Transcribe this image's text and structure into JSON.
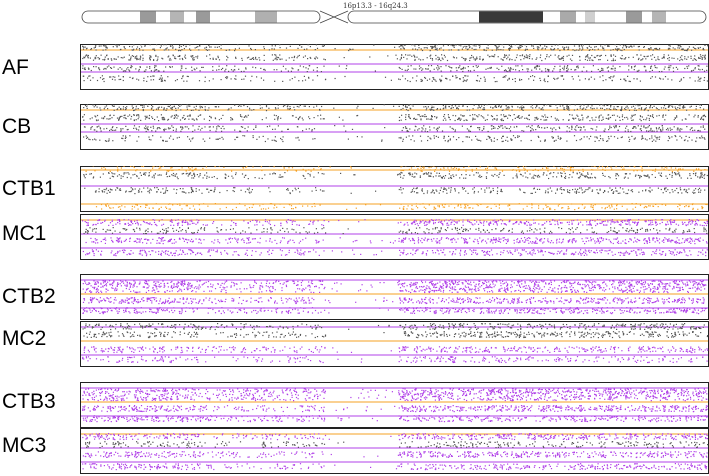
{
  "chromosome": {
    "region_label": "16p13.3 - 16q24.3"
  },
  "colors": {
    "purple": "#b040e8",
    "orange": "#f5a023",
    "gray": "#555555",
    "frame": "#222222"
  },
  "tracks": [
    {
      "id": "AF",
      "label": "AF",
      "style": "parent"
    },
    {
      "id": "CB",
      "label": "CB",
      "style": "parent"
    },
    {
      "id": "CTB1",
      "label": "CTB1",
      "style": "ctb1"
    },
    {
      "id": "MC1",
      "label": "MC1",
      "style": "mc"
    },
    {
      "id": "CTB2",
      "label": "CTB2",
      "style": "ctb"
    },
    {
      "id": "MC2",
      "label": "MC2",
      "style": "mc2"
    },
    {
      "id": "CTB3",
      "label": "CTB3",
      "style": "ctb"
    },
    {
      "id": "MC3",
      "label": "MC3",
      "style": "mc"
    }
  ]
}
